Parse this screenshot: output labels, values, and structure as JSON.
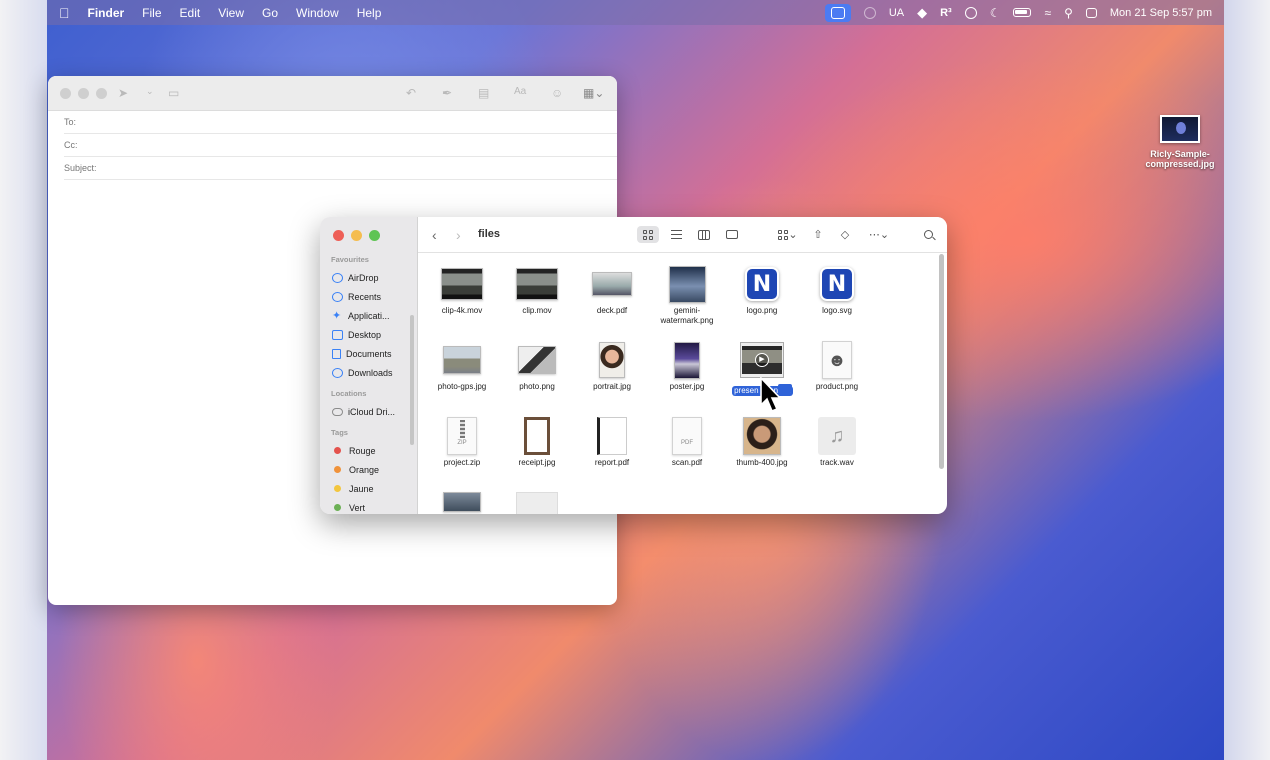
{
  "menubar": {
    "apple": "",
    "app": "Finder",
    "menus": [
      "File",
      "Edit",
      "View",
      "Go",
      "Window",
      "Help"
    ],
    "status": {
      "keyboard": "UA",
      "r_icon": "R³",
      "datetime": "Mon 21 Sep  5:57 pm"
    }
  },
  "desktop": {
    "file_name": "Ricly-Sample-compressed.jpg"
  },
  "mail": {
    "to_label": "To:",
    "cc_label": "Cc:",
    "subject_label": "Subject:"
  },
  "finder": {
    "title": "files",
    "sidebar": {
      "favourites_label": "Favourites",
      "favourites": [
        "AirDrop",
        "Recents",
        "Applicati...",
        "Desktop",
        "Documents",
        "Downloads"
      ],
      "locations_label": "Locations",
      "locations": [
        "iCloud Dri..."
      ],
      "tags_label": "Tags",
      "tags": [
        {
          "name": "Rouge",
          "color": "#e4524d"
        },
        {
          "name": "Orange",
          "color": "#f0923a"
        },
        {
          "name": "Jaune",
          "color": "#f3c63e"
        },
        {
          "name": "Vert",
          "color": "#6cb055"
        }
      ]
    },
    "files": [
      {
        "name": "clip-4k.mov"
      },
      {
        "name": "clip.mov"
      },
      {
        "name": "deck.pdf"
      },
      {
        "name": "gemini-watermark.png"
      },
      {
        "name": "logo.png"
      },
      {
        "name": "logo.svg"
      },
      {
        "name": "photo-gps.jpg"
      },
      {
        "name": "photo.png"
      },
      {
        "name": "portrait.jpg"
      },
      {
        "name": "poster.jpg"
      },
      {
        "name": "presentation-4k.mov"
      },
      {
        "name": "product.png"
      },
      {
        "name": "project.zip"
      },
      {
        "name": "receipt.jpg"
      },
      {
        "name": "report.pdf"
      },
      {
        "name": "scan.pdf"
      },
      {
        "name": "thumb-400.jpg"
      },
      {
        "name": "track.wav"
      }
    ],
    "selected_label_part1": "presen",
    "selected_label_part2": "tion-4k.",
    "file_types": {
      "zip": "ZIP",
      "pdf": "PDF"
    }
  }
}
